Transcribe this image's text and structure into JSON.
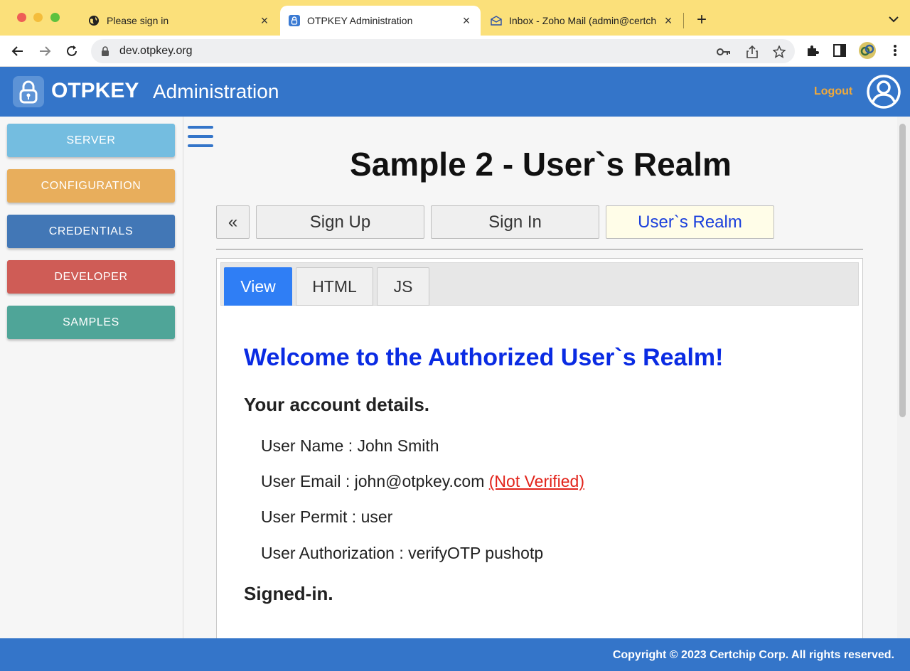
{
  "browser": {
    "tabs": [
      {
        "title": "Please sign in",
        "icon": "globe-icon"
      },
      {
        "title": "OTPKEY Administration",
        "icon": "otpkey-lock-icon"
      },
      {
        "title": "Inbox - Zoho Mail (admin@certchip",
        "icon": "mail-icon"
      }
    ],
    "url": "dev.otpkey.org"
  },
  "header": {
    "brand": "OTPKEY",
    "subtitle": "Administration",
    "logout_label": "Logout"
  },
  "sidebar": {
    "items": [
      {
        "label": "SERVER",
        "color": "#74bde0"
      },
      {
        "label": "CONFIGURATION",
        "color": "#e8ae5c"
      },
      {
        "label": "CREDENTIALS",
        "color": "#4277b6"
      },
      {
        "label": "DEVELOPER",
        "color": "#cf5c56"
      },
      {
        "label": "SAMPLES",
        "color": "#4fa598"
      }
    ]
  },
  "main": {
    "title": "Sample 2 - User`s Realm",
    "sample_nav": {
      "back_label": "«",
      "items": [
        "Sign Up",
        "Sign In",
        "User`s Realm"
      ],
      "active": "User`s Realm"
    },
    "panel_tabs": [
      "View",
      "HTML",
      "JS"
    ],
    "active_panel_tab": "View",
    "view": {
      "welcome": "Welcome to the Authorized User`s Realm!",
      "account_heading": "Your account details.",
      "user_name": "User Name : John Smith",
      "user_email": "User Email : john@otpkey.com",
      "email_status": "(Not Verified)",
      "user_permit": "User Permit : user",
      "user_authorization": "User Authorization : verifyOTP pushotp",
      "signed_status": "Signed-in."
    }
  },
  "footer": {
    "copyright": "Copyright © 2023 Certchip Corp. All rights reserved."
  },
  "colors": {
    "header_bg": "#3475c9",
    "tabbar_bg": "#fbe07a",
    "logout": "#f0a93a",
    "welcome": "#0a2be3",
    "active_tab": "#2f7ef5",
    "not_verified": "#e2231a"
  }
}
